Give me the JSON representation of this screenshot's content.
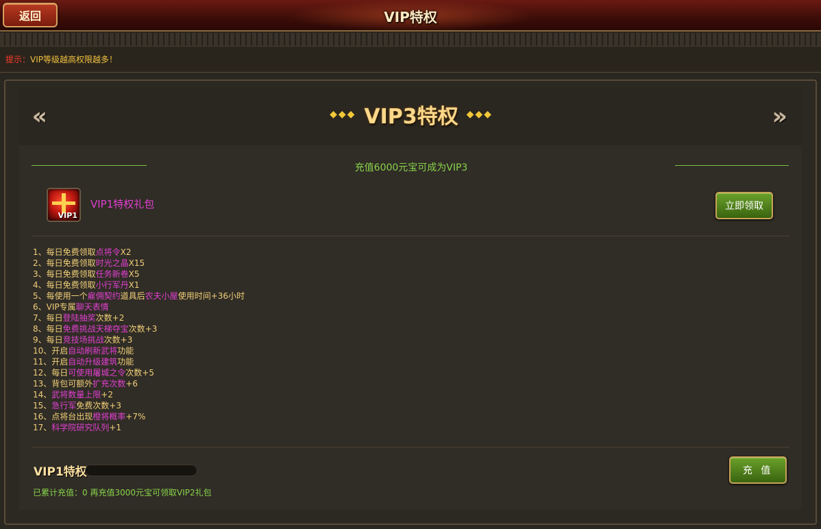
{
  "header": {
    "back_label": "返回",
    "title": "VIP特权"
  },
  "tip": {
    "label": "提示：",
    "text": "VIP等级越高权限越多！"
  },
  "level_nav": {
    "diamonds_left": "◆◆◆",
    "title": "VIP3特权",
    "diamonds_right": "◆◆◆",
    "prev_icon": "double-chevron-left",
    "next_icon": "double-chevron-right"
  },
  "recharge_requirement": "充值6000元宝可成为VIP3",
  "gift": {
    "icon": "gift-box-icon",
    "icon_tag": "VIP1",
    "name": "VIP1特权礼包",
    "claim_label": "立即领取"
  },
  "perks": [
    {
      "parts": [
        [
          "1、每日免费领取",
          "txt"
        ],
        [
          "点将令",
          "hl"
        ],
        [
          "X2",
          "txt"
        ]
      ]
    },
    {
      "parts": [
        [
          "2、每日免费领取",
          "txt"
        ],
        [
          "时光之晶",
          "hl"
        ],
        [
          "X15",
          "txt"
        ]
      ]
    },
    {
      "parts": [
        [
          "3、每日免费领取",
          "txt"
        ],
        [
          "任务新卷",
          "hl"
        ],
        [
          "X5",
          "txt"
        ]
      ]
    },
    {
      "parts": [
        [
          "4、每日免费领取",
          "txt"
        ],
        [
          "小行军丹",
          "hl"
        ],
        [
          "X1",
          "txt"
        ]
      ]
    },
    {
      "parts": [
        [
          "5、每使用一个",
          "txt"
        ],
        [
          "雇佣契约",
          "hl"
        ],
        [
          "道具后",
          "txt"
        ],
        [
          "农夫小屋",
          "hl"
        ],
        [
          "使用时间+36小时",
          "txt"
        ]
      ]
    },
    {
      "parts": [
        [
          "6、VIP专属",
          "txt"
        ],
        [
          "聊天表情",
          "hl"
        ]
      ]
    },
    {
      "parts": [
        [
          "7、每日",
          "txt"
        ],
        [
          "登陆抽奖",
          "hl"
        ],
        [
          "次数+2",
          "txt"
        ]
      ]
    },
    {
      "parts": [
        [
          "8、每日",
          "txt"
        ],
        [
          "免费挑战天梯夺宝",
          "hl"
        ],
        [
          "次数+3",
          "txt"
        ]
      ]
    },
    {
      "parts": [
        [
          "9、每日",
          "txt"
        ],
        [
          "竞技场挑战",
          "hl"
        ],
        [
          "次数+3",
          "txt"
        ]
      ]
    },
    {
      "parts": [
        [
          "10、开启",
          "txt"
        ],
        [
          "自动刷新武将",
          "hl"
        ],
        [
          "功能",
          "txt"
        ]
      ]
    },
    {
      "parts": [
        [
          "11、开启",
          "txt"
        ],
        [
          "自动升级建筑",
          "hl"
        ],
        [
          "功能",
          "txt"
        ]
      ]
    },
    {
      "parts": [
        [
          "12、每日",
          "txt"
        ],
        [
          "可使用屠城之令",
          "hl"
        ],
        [
          "次数+5",
          "txt"
        ]
      ]
    },
    {
      "parts": [
        [
          "13、背包可额外",
          "txt"
        ],
        [
          "扩充次数",
          "hl"
        ],
        [
          "+6",
          "txt"
        ]
      ]
    },
    {
      "parts": [
        [
          "14、",
          "txt"
        ],
        [
          "武将数量上限",
          "hl"
        ],
        [
          "+2",
          "txt"
        ]
      ]
    },
    {
      "parts": [
        [
          "15、",
          "txt"
        ],
        [
          "急行军",
          "hl"
        ],
        [
          "免费次数+3",
          "txt"
        ]
      ]
    },
    {
      "parts": [
        [
          "16、点将台出现",
          "txt"
        ],
        [
          "橙将概率",
          "hl"
        ],
        [
          "+7%",
          "txt"
        ]
      ]
    },
    {
      "parts": [
        [
          "17、",
          "txt"
        ],
        [
          "科学院研究队列",
          "hl"
        ],
        [
          "+1",
          "txt"
        ]
      ]
    }
  ],
  "status": {
    "current_vip": "VIP1特权",
    "progress_fraction": 0,
    "recharge_label": "充 值",
    "cumulative_text": "已累计充值：0 再充值3000元宝可领取VIP2礼包"
  },
  "colors": {
    "highlight": "#e040d0",
    "perk_text": "#f0d078",
    "accent_green": "#88d44a",
    "tip_red": "#ff3a2a",
    "tip_yellow": "#f0c040",
    "title_gold": "#fbd88a"
  }
}
